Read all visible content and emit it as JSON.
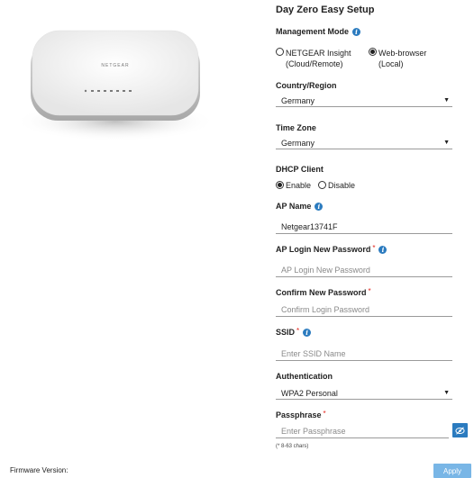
{
  "page_title": "Day Zero Easy Setup",
  "device": {
    "brand_label": "NETGEAR"
  },
  "management_mode": {
    "label": "Management Mode",
    "options": [
      {
        "line1": "NETGEAR Insight",
        "line2": "(Cloud/Remote)",
        "selected": false
      },
      {
        "line1": "Web-browser",
        "line2": "(Local)",
        "selected": true
      }
    ]
  },
  "country": {
    "label": "Country/Region",
    "value": "Germany"
  },
  "timezone": {
    "label": "Time Zone",
    "value": "Germany"
  },
  "dhcp": {
    "label": "DHCP Client",
    "options": [
      {
        "text": "Enable",
        "selected": true
      },
      {
        "text": "Disable",
        "selected": false
      }
    ]
  },
  "ap_name": {
    "label": "AP Name",
    "value": "Netgear13741F"
  },
  "login_password": {
    "label": "AP Login New Password",
    "required_mark": "*",
    "placeholder": "AP Login New Password"
  },
  "confirm_password": {
    "label": "Confirm New Password",
    "required_mark": "*",
    "placeholder": "Confirm Login Password"
  },
  "ssid": {
    "label": "SSID",
    "required_mark": "*",
    "placeholder": "Enter SSID Name"
  },
  "authentication": {
    "label": "Authentication",
    "value": "WPA2 Personal"
  },
  "passphrase": {
    "label": "Passphrase",
    "required_mark": "*",
    "placeholder": "Enter Passphrase",
    "hint": "(* 8-63 chars)"
  },
  "apply_label": "Apply",
  "firmware_label": "Firmware Version:",
  "colors": {
    "accent": "#2b7bbf",
    "apply": "#79b6e6",
    "required": "#e2231a"
  }
}
